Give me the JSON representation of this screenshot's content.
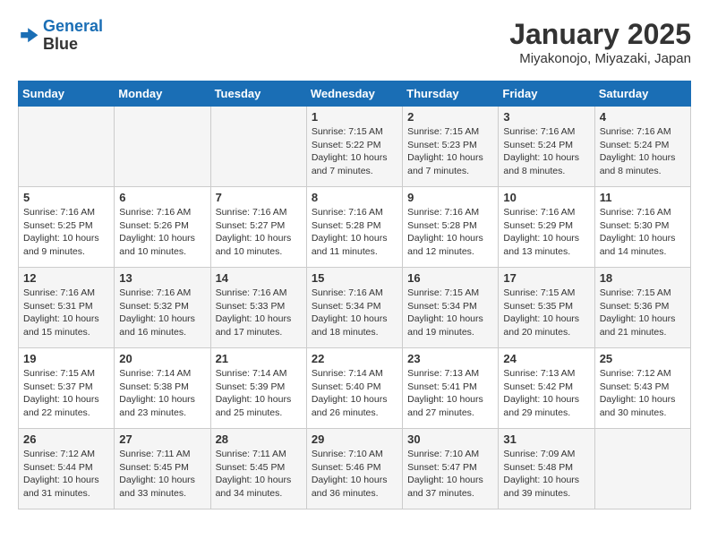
{
  "logo": {
    "line1": "General",
    "line2": "Blue"
  },
  "title": "January 2025",
  "subtitle": "Miyakonojo, Miyazaki, Japan",
  "weekdays": [
    "Sunday",
    "Monday",
    "Tuesday",
    "Wednesday",
    "Thursday",
    "Friday",
    "Saturday"
  ],
  "weeks": [
    [
      {
        "day": "",
        "sunrise": "",
        "sunset": "",
        "daylight": ""
      },
      {
        "day": "",
        "sunrise": "",
        "sunset": "",
        "daylight": ""
      },
      {
        "day": "",
        "sunrise": "",
        "sunset": "",
        "daylight": ""
      },
      {
        "day": "1",
        "sunrise": "Sunrise: 7:15 AM",
        "sunset": "Sunset: 5:22 PM",
        "daylight": "Daylight: 10 hours and 7 minutes."
      },
      {
        "day": "2",
        "sunrise": "Sunrise: 7:15 AM",
        "sunset": "Sunset: 5:23 PM",
        "daylight": "Daylight: 10 hours and 7 minutes."
      },
      {
        "day": "3",
        "sunrise": "Sunrise: 7:16 AM",
        "sunset": "Sunset: 5:24 PM",
        "daylight": "Daylight: 10 hours and 8 minutes."
      },
      {
        "day": "4",
        "sunrise": "Sunrise: 7:16 AM",
        "sunset": "Sunset: 5:24 PM",
        "daylight": "Daylight: 10 hours and 8 minutes."
      }
    ],
    [
      {
        "day": "5",
        "sunrise": "Sunrise: 7:16 AM",
        "sunset": "Sunset: 5:25 PM",
        "daylight": "Daylight: 10 hours and 9 minutes."
      },
      {
        "day": "6",
        "sunrise": "Sunrise: 7:16 AM",
        "sunset": "Sunset: 5:26 PM",
        "daylight": "Daylight: 10 hours and 10 minutes."
      },
      {
        "day": "7",
        "sunrise": "Sunrise: 7:16 AM",
        "sunset": "Sunset: 5:27 PM",
        "daylight": "Daylight: 10 hours and 10 minutes."
      },
      {
        "day": "8",
        "sunrise": "Sunrise: 7:16 AM",
        "sunset": "Sunset: 5:28 PM",
        "daylight": "Daylight: 10 hours and 11 minutes."
      },
      {
        "day": "9",
        "sunrise": "Sunrise: 7:16 AM",
        "sunset": "Sunset: 5:28 PM",
        "daylight": "Daylight: 10 hours and 12 minutes."
      },
      {
        "day": "10",
        "sunrise": "Sunrise: 7:16 AM",
        "sunset": "Sunset: 5:29 PM",
        "daylight": "Daylight: 10 hours and 13 minutes."
      },
      {
        "day": "11",
        "sunrise": "Sunrise: 7:16 AM",
        "sunset": "Sunset: 5:30 PM",
        "daylight": "Daylight: 10 hours and 14 minutes."
      }
    ],
    [
      {
        "day": "12",
        "sunrise": "Sunrise: 7:16 AM",
        "sunset": "Sunset: 5:31 PM",
        "daylight": "Daylight: 10 hours and 15 minutes."
      },
      {
        "day": "13",
        "sunrise": "Sunrise: 7:16 AM",
        "sunset": "Sunset: 5:32 PM",
        "daylight": "Daylight: 10 hours and 16 minutes."
      },
      {
        "day": "14",
        "sunrise": "Sunrise: 7:16 AM",
        "sunset": "Sunset: 5:33 PM",
        "daylight": "Daylight: 10 hours and 17 minutes."
      },
      {
        "day": "15",
        "sunrise": "Sunrise: 7:16 AM",
        "sunset": "Sunset: 5:34 PM",
        "daylight": "Daylight: 10 hours and 18 minutes."
      },
      {
        "day": "16",
        "sunrise": "Sunrise: 7:15 AM",
        "sunset": "Sunset: 5:34 PM",
        "daylight": "Daylight: 10 hours and 19 minutes."
      },
      {
        "day": "17",
        "sunrise": "Sunrise: 7:15 AM",
        "sunset": "Sunset: 5:35 PM",
        "daylight": "Daylight: 10 hours and 20 minutes."
      },
      {
        "day": "18",
        "sunrise": "Sunrise: 7:15 AM",
        "sunset": "Sunset: 5:36 PM",
        "daylight": "Daylight: 10 hours and 21 minutes."
      }
    ],
    [
      {
        "day": "19",
        "sunrise": "Sunrise: 7:15 AM",
        "sunset": "Sunset: 5:37 PM",
        "daylight": "Daylight: 10 hours and 22 minutes."
      },
      {
        "day": "20",
        "sunrise": "Sunrise: 7:14 AM",
        "sunset": "Sunset: 5:38 PM",
        "daylight": "Daylight: 10 hours and 23 minutes."
      },
      {
        "day": "21",
        "sunrise": "Sunrise: 7:14 AM",
        "sunset": "Sunset: 5:39 PM",
        "daylight": "Daylight: 10 hours and 25 minutes."
      },
      {
        "day": "22",
        "sunrise": "Sunrise: 7:14 AM",
        "sunset": "Sunset: 5:40 PM",
        "daylight": "Daylight: 10 hours and 26 minutes."
      },
      {
        "day": "23",
        "sunrise": "Sunrise: 7:13 AM",
        "sunset": "Sunset: 5:41 PM",
        "daylight": "Daylight: 10 hours and 27 minutes."
      },
      {
        "day": "24",
        "sunrise": "Sunrise: 7:13 AM",
        "sunset": "Sunset: 5:42 PM",
        "daylight": "Daylight: 10 hours and 29 minutes."
      },
      {
        "day": "25",
        "sunrise": "Sunrise: 7:12 AM",
        "sunset": "Sunset: 5:43 PM",
        "daylight": "Daylight: 10 hours and 30 minutes."
      }
    ],
    [
      {
        "day": "26",
        "sunrise": "Sunrise: 7:12 AM",
        "sunset": "Sunset: 5:44 PM",
        "daylight": "Daylight: 10 hours and 31 minutes."
      },
      {
        "day": "27",
        "sunrise": "Sunrise: 7:11 AM",
        "sunset": "Sunset: 5:45 PM",
        "daylight": "Daylight: 10 hours and 33 minutes."
      },
      {
        "day": "28",
        "sunrise": "Sunrise: 7:11 AM",
        "sunset": "Sunset: 5:45 PM",
        "daylight": "Daylight: 10 hours and 34 minutes."
      },
      {
        "day": "29",
        "sunrise": "Sunrise: 7:10 AM",
        "sunset": "Sunset: 5:46 PM",
        "daylight": "Daylight: 10 hours and 36 minutes."
      },
      {
        "day": "30",
        "sunrise": "Sunrise: 7:10 AM",
        "sunset": "Sunset: 5:47 PM",
        "daylight": "Daylight: 10 hours and 37 minutes."
      },
      {
        "day": "31",
        "sunrise": "Sunrise: 7:09 AM",
        "sunset": "Sunset: 5:48 PM",
        "daylight": "Daylight: 10 hours and 39 minutes."
      },
      {
        "day": "",
        "sunrise": "",
        "sunset": "",
        "daylight": ""
      }
    ]
  ]
}
